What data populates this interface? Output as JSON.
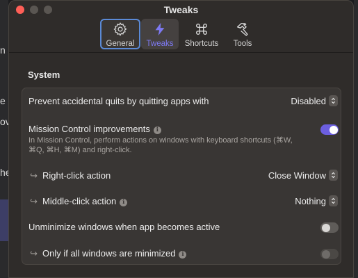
{
  "window": {
    "title": "Tweaks"
  },
  "background": {
    "fragment_1": "n",
    "fragment_2": "e",
    "fragment_3": "ov",
    "fragment_4": "he"
  },
  "tabs": [
    {
      "label": "General",
      "icon": "gear-icon"
    },
    {
      "label": "Tweaks",
      "icon": "bolt-icon"
    },
    {
      "label": "Shortcuts",
      "icon": "command-icon"
    },
    {
      "label": "Tools",
      "icon": "hammer-icon"
    }
  ],
  "section": {
    "title": "System"
  },
  "settings": {
    "prevent_quits": {
      "label": "Prevent accidental quits by quitting apps with",
      "value": "Disabled"
    },
    "mission_control": {
      "label": "Mission Control improvements",
      "description": "In Mission Control, perform actions on windows with keyboard shortcuts (⌘W, ⌘Q, ⌘H, ⌘M) and right-click.",
      "enabled": true
    },
    "right_click": {
      "arrow": "↪",
      "label": "Right-click action",
      "value": "Close Window"
    },
    "middle_click": {
      "arrow": "↪",
      "label": "Middle-click action",
      "value": "Nothing"
    },
    "unminimize": {
      "label": "Unminimize windows when app becomes active",
      "enabled": false
    },
    "only_if_minimized": {
      "arrow": "↪",
      "label": "Only if all windows are minimized",
      "enabled": false,
      "disabled": true
    }
  },
  "colors": {
    "accent": "#6c5fe0",
    "selected_tab_border": "#5b8ad6",
    "tweaks_label": "#7d79f2"
  }
}
